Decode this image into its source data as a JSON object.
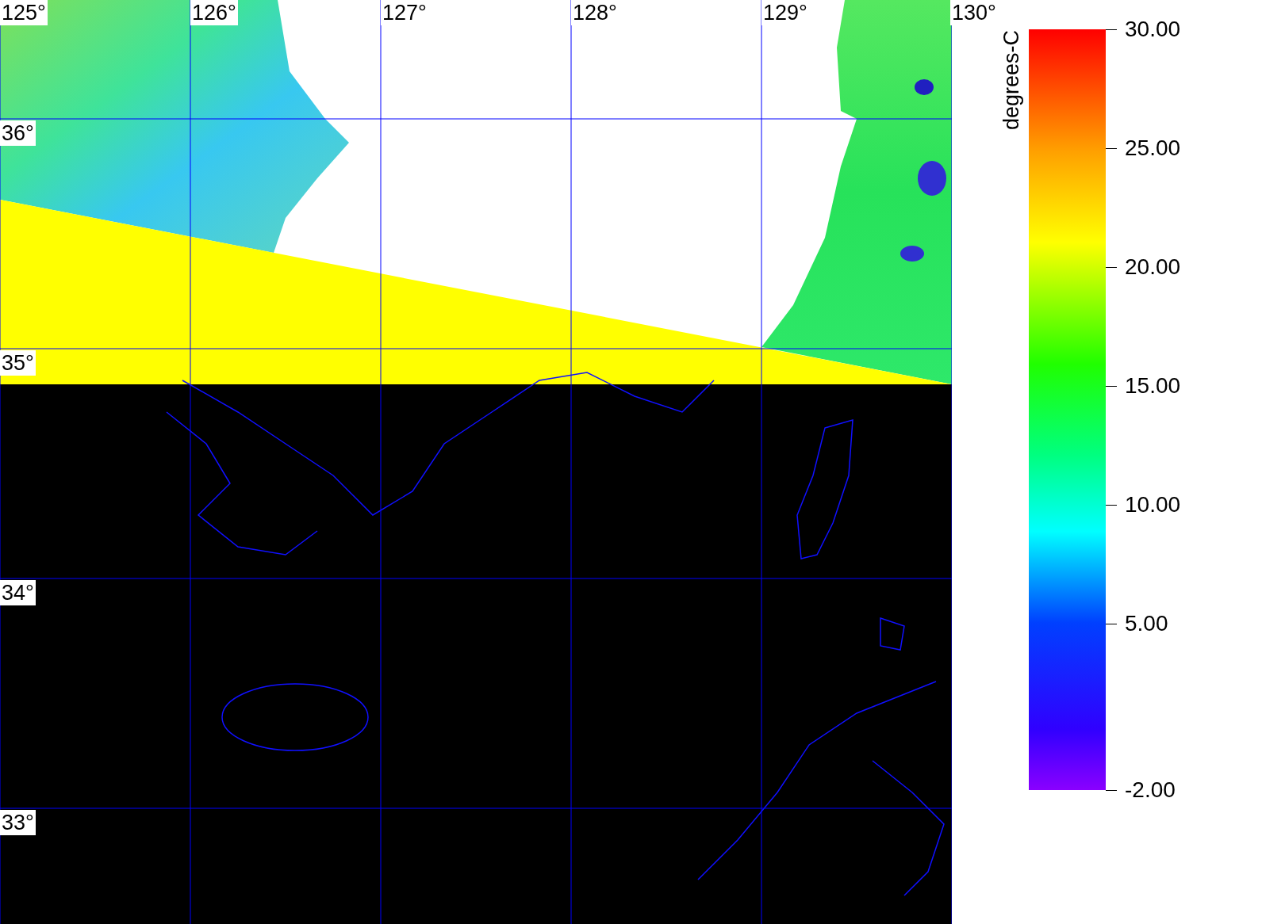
{
  "map": {
    "longitude_labels": [
      "125°",
      "126°",
      "127°",
      "128°",
      "129°",
      "130°"
    ],
    "latitude_labels": [
      "36°",
      "35°",
      "34°",
      "33°"
    ]
  },
  "legend": {
    "unit": "degrees-C",
    "ticks": [
      "30.00",
      "25.00",
      "20.00",
      "15.00",
      "10.00",
      "5.00",
      "-2.00"
    ]
  }
}
